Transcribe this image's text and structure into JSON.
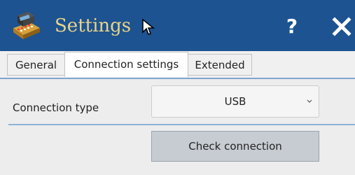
{
  "window": {
    "title": "Settings",
    "app_icon": "calculator-register-icon",
    "help_label": "?",
    "close_icon": "close-icon",
    "title_bar_color": "#1c5390",
    "title_text_color": "#e9d38c"
  },
  "tabs": [
    {
      "label": "General",
      "active": false
    },
    {
      "label": "Connection settings",
      "active": true
    },
    {
      "label": "Extended",
      "active": false
    }
  ],
  "connection": {
    "label": "Connection type",
    "selected": "USB",
    "check_button_label": "Check connection"
  }
}
